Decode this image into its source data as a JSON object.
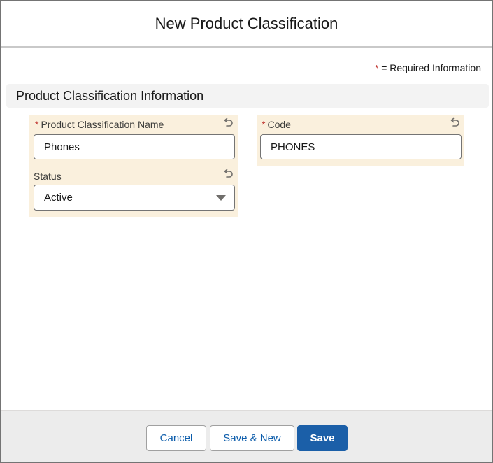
{
  "modal": {
    "title": "New Product Classification",
    "required_star": "*",
    "required_legend": "= Required Information"
  },
  "section": {
    "title": "Product Classification Information"
  },
  "fields": {
    "name": {
      "required": "*",
      "label": "Product Classification Name",
      "value": "Phones"
    },
    "code": {
      "required": "*",
      "label": "Code",
      "value": "PHONES"
    },
    "status": {
      "label": "Status",
      "value": "Active"
    }
  },
  "footer": {
    "cancel_label": "Cancel",
    "save_new_label": "Save & New",
    "save_label": "Save"
  },
  "colors": {
    "changed_field_bg": "#faf0dd",
    "brand": "#1b5fa8",
    "required": "#c23934"
  }
}
